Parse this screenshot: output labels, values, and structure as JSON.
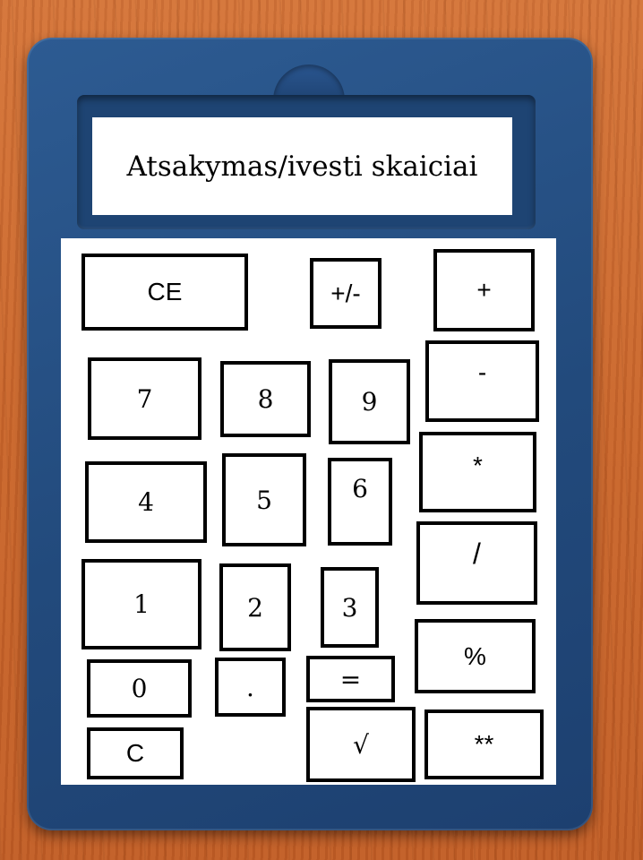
{
  "display": {
    "text": "Atsakymas/ivesti skaiciai"
  },
  "keys": {
    "ce": "CE",
    "sign": "+/-",
    "plus": "+",
    "minus": "-",
    "seven": "7",
    "eight": "8",
    "nine": "9",
    "four": "4",
    "five": "5",
    "six": "6",
    "multiply": "*",
    "divide": "/",
    "one": "1",
    "two": "2",
    "three": "3",
    "percent": "%",
    "zero": "0",
    "dot": ".",
    "equals": "=",
    "clear": "C",
    "sqrt": "√",
    "power": "**"
  }
}
